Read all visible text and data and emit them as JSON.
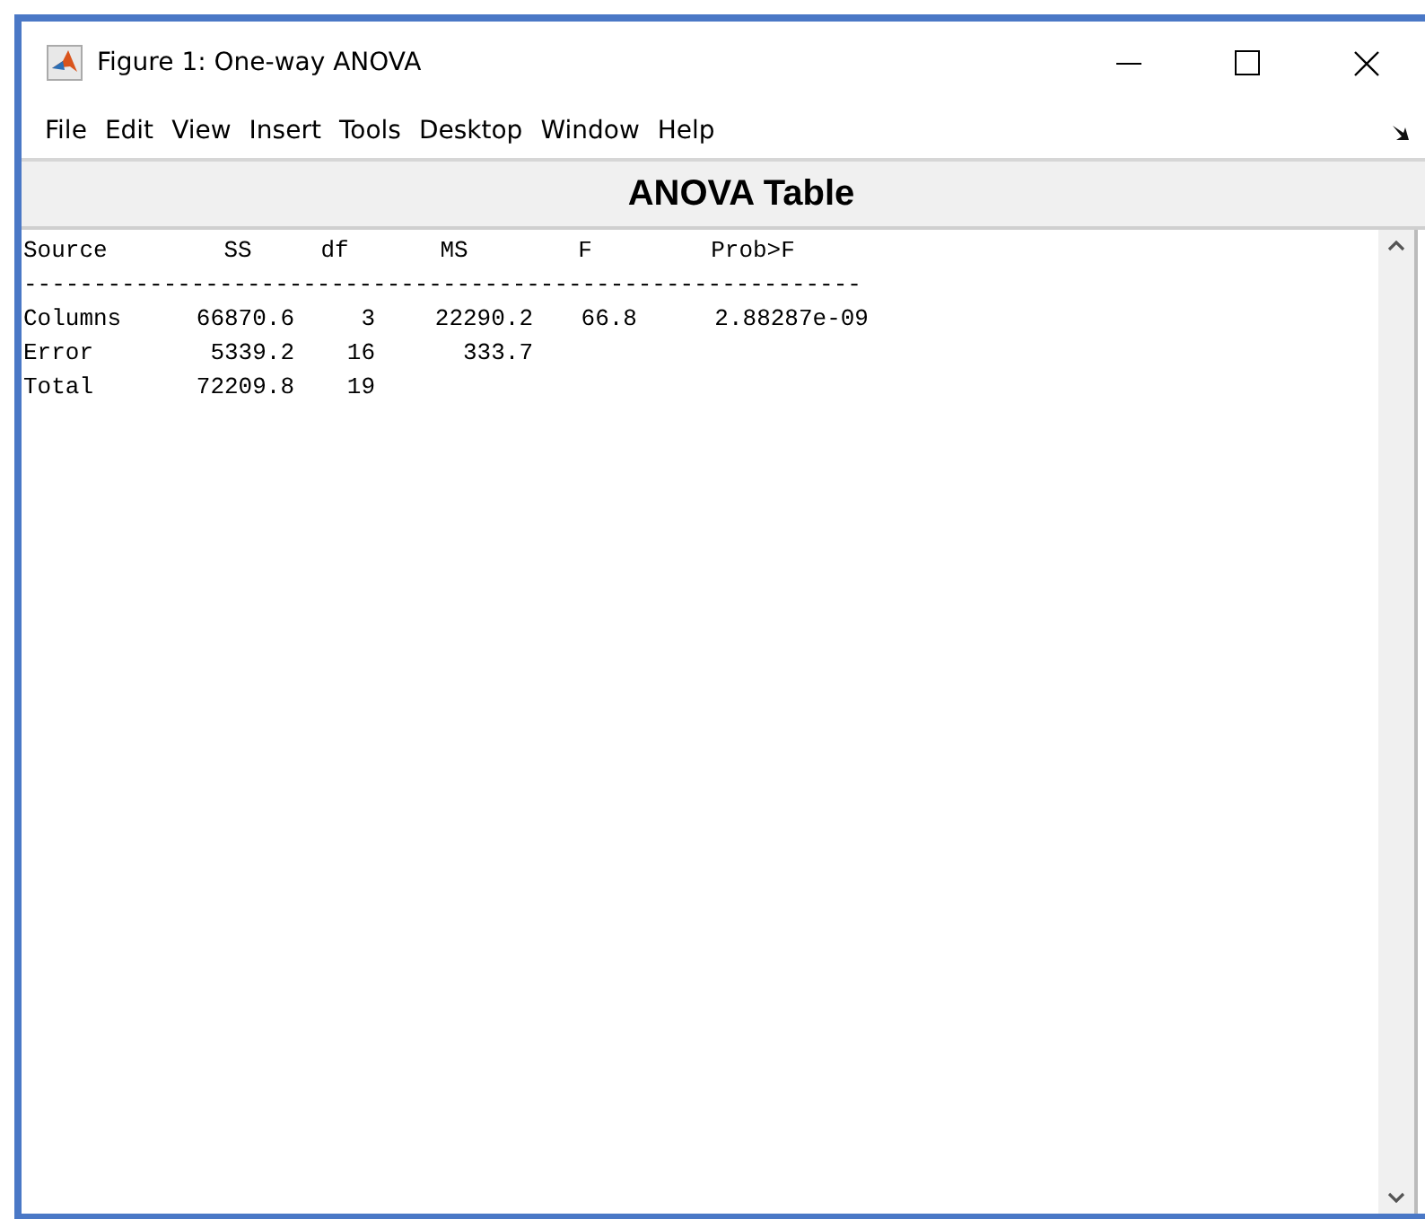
{
  "window": {
    "title": "Figure 1: One-way ANOVA"
  },
  "menu": [
    "File",
    "Edit",
    "View",
    "Insert",
    "Tools",
    "Desktop",
    "Window",
    "Help"
  ],
  "heading": "ANOVA Table",
  "table": {
    "columns": [
      "Source",
      "SS",
      "df",
      "MS",
      "F",
      "Prob>F"
    ],
    "rule": "------------------------------------------------------------",
    "rows": [
      [
        "Columns",
        "66870.6",
        "3",
        "22290.2",
        "66.8",
        "2.88287e-09"
      ],
      [
        "Error",
        "5339.2",
        "16",
        "333.7"
      ],
      [
        "Total",
        "72209.8",
        "19"
      ]
    ]
  }
}
